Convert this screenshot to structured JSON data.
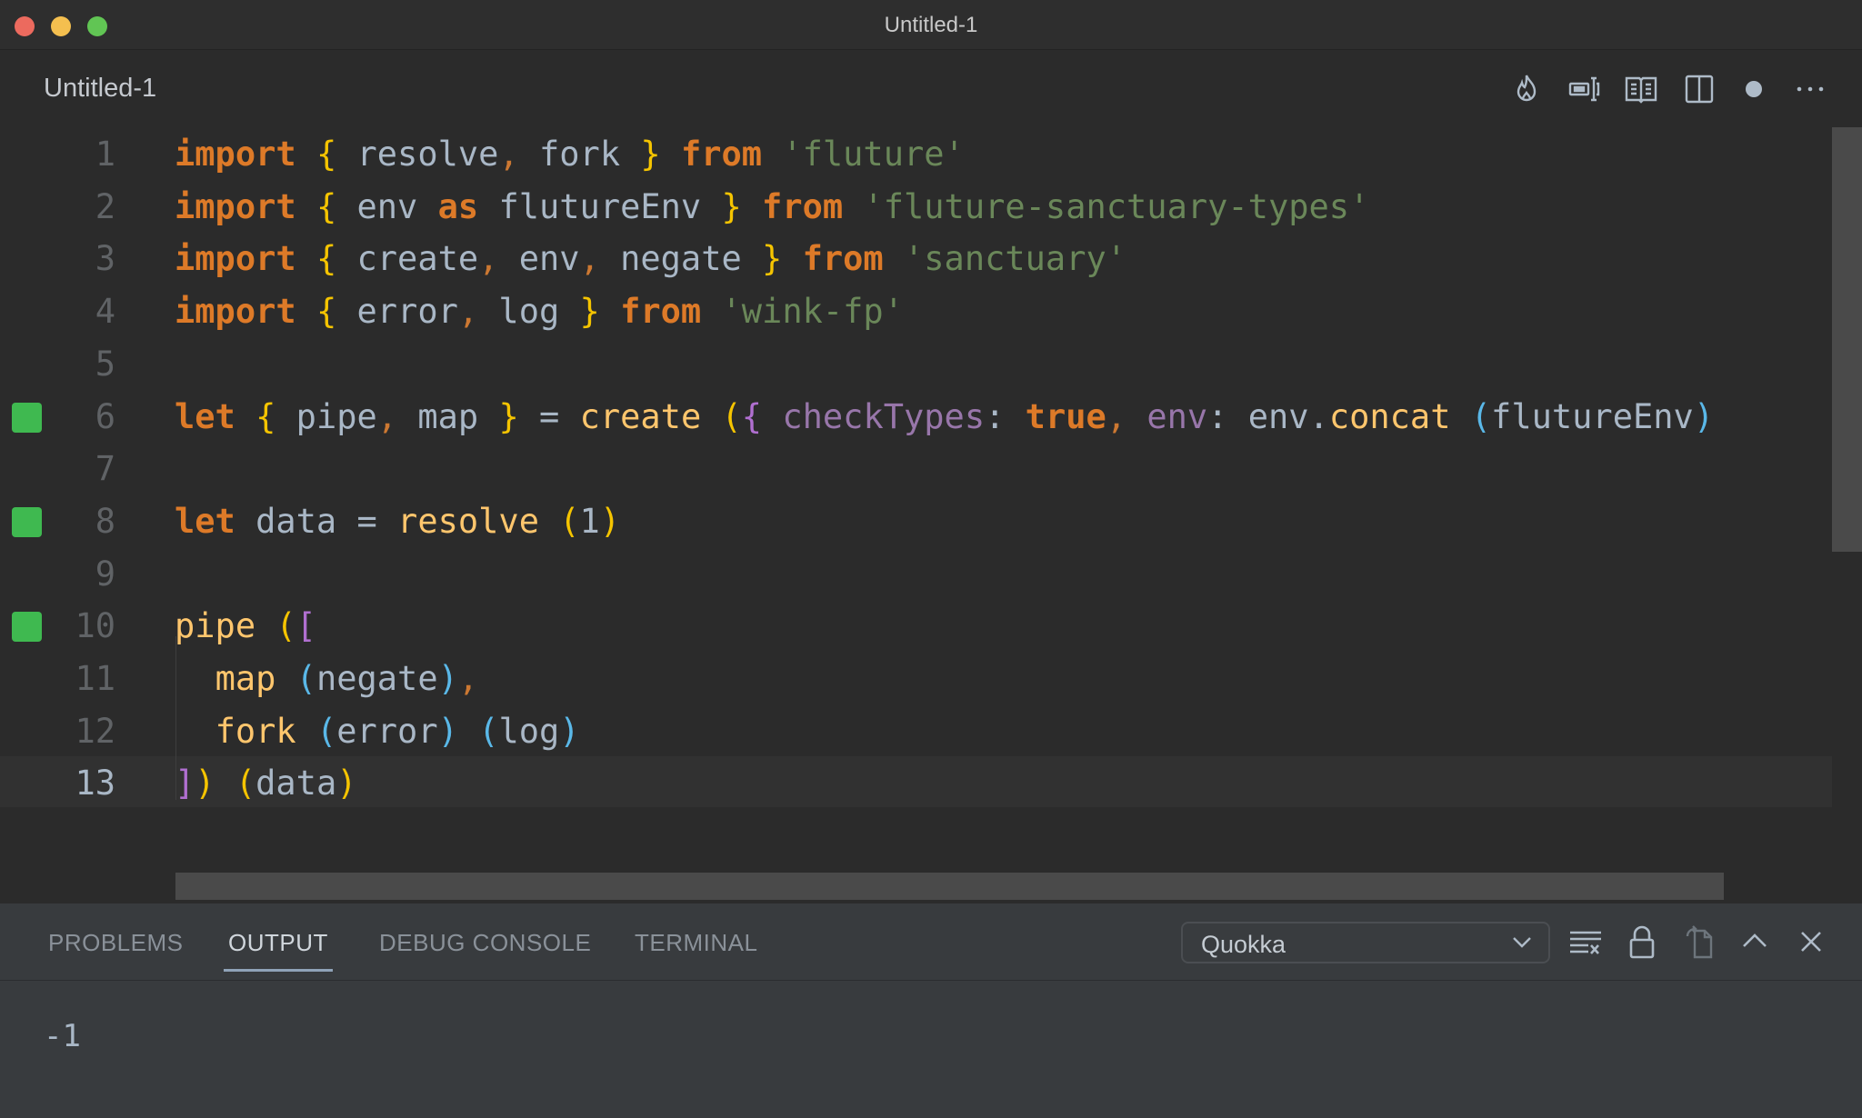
{
  "window": {
    "title": "Untitled-1"
  },
  "editor_tab": {
    "label": "Untitled-1"
  },
  "toolbar_icons": [
    "flame-icon",
    "text-cursor-icon",
    "open-preview-icon",
    "split-editor-icon",
    "unsaved-dot-icon",
    "more-actions-icon"
  ],
  "code_lines": [
    {
      "n": "1",
      "marker": false,
      "tokens": [
        [
          "import",
          "kw"
        ],
        [
          " ",
          ""
        ],
        [
          "{",
          "br"
        ],
        [
          " resolve",
          ""
        ],
        [
          ",",
          "punc"
        ],
        [
          " fork ",
          ""
        ],
        [
          "}",
          "br"
        ],
        [
          " ",
          ""
        ],
        [
          "from",
          "kw"
        ],
        [
          " ",
          ""
        ],
        [
          "'fluture'",
          "str"
        ]
      ]
    },
    {
      "n": "2",
      "marker": false,
      "tokens": [
        [
          "import",
          "kw"
        ],
        [
          " ",
          ""
        ],
        [
          "{",
          "br"
        ],
        [
          " env ",
          ""
        ],
        [
          "as",
          "kw"
        ],
        [
          " flutureEnv ",
          ""
        ],
        [
          "}",
          "br"
        ],
        [
          " ",
          ""
        ],
        [
          "from",
          "kw"
        ],
        [
          " ",
          ""
        ],
        [
          "'fluture-sanctuary-types'",
          "str"
        ]
      ]
    },
    {
      "n": "3",
      "marker": false,
      "tokens": [
        [
          "import",
          "kw"
        ],
        [
          " ",
          ""
        ],
        [
          "{",
          "br"
        ],
        [
          " create",
          ""
        ],
        [
          ",",
          "punc"
        ],
        [
          " env",
          ""
        ],
        [
          ",",
          "punc"
        ],
        [
          " negate ",
          ""
        ],
        [
          "}",
          "br"
        ],
        [
          " ",
          ""
        ],
        [
          "from",
          "kw"
        ],
        [
          " ",
          ""
        ],
        [
          "'sanctuary'",
          "str"
        ]
      ]
    },
    {
      "n": "4",
      "marker": false,
      "tokens": [
        [
          "import",
          "kw"
        ],
        [
          " ",
          ""
        ],
        [
          "{",
          "br"
        ],
        [
          " error",
          ""
        ],
        [
          ",",
          "punc"
        ],
        [
          " log ",
          ""
        ],
        [
          "}",
          "br"
        ],
        [
          " ",
          ""
        ],
        [
          "from",
          "kw"
        ],
        [
          " ",
          ""
        ],
        [
          "'wink-fp'",
          "str"
        ]
      ]
    },
    {
      "n": "5",
      "marker": false,
      "tokens": []
    },
    {
      "n": "6",
      "marker": true,
      "tokens": [
        [
          "let",
          "kw"
        ],
        [
          " ",
          ""
        ],
        [
          "{",
          "br"
        ],
        [
          " pipe",
          ""
        ],
        [
          ",",
          "punc"
        ],
        [
          " map ",
          ""
        ],
        [
          "}",
          "br"
        ],
        [
          " = ",
          ""
        ],
        [
          "create",
          "fn"
        ],
        [
          " ",
          ""
        ],
        [
          "(",
          "br"
        ],
        [
          "{",
          "pur"
        ],
        [
          " ",
          ""
        ],
        [
          "checkTypes",
          "prop"
        ],
        [
          ": ",
          ""
        ],
        [
          "true",
          "kw"
        ],
        [
          ",",
          "punc"
        ],
        [
          " ",
          ""
        ],
        [
          "env",
          "prop"
        ],
        [
          ": env.",
          ""
        ],
        [
          "concat",
          "fn"
        ],
        [
          " ",
          ""
        ],
        [
          "(",
          "blue"
        ],
        [
          "flutureEnv",
          ""
        ],
        [
          ")",
          "blue"
        ]
      ]
    },
    {
      "n": "7",
      "marker": false,
      "tokens": []
    },
    {
      "n": "8",
      "marker": true,
      "tokens": [
        [
          "let",
          "kw"
        ],
        [
          " data = ",
          ""
        ],
        [
          "resolve",
          "fn"
        ],
        [
          " ",
          ""
        ],
        [
          "(",
          "br"
        ],
        [
          "1",
          "num"
        ],
        [
          ")",
          "br"
        ]
      ]
    },
    {
      "n": "9",
      "marker": false,
      "tokens": []
    },
    {
      "n": "10",
      "marker": true,
      "tokens": [
        [
          "pipe",
          "fn"
        ],
        [
          " ",
          ""
        ],
        [
          "(",
          "br"
        ],
        [
          "[",
          "pur"
        ]
      ]
    },
    {
      "n": "11",
      "marker": false,
      "tokens": [
        [
          "  ",
          ""
        ],
        [
          "map",
          "fn"
        ],
        [
          " ",
          ""
        ],
        [
          "(",
          "blue"
        ],
        [
          "negate",
          ""
        ],
        [
          ")",
          "blue"
        ],
        [
          ",",
          "punc"
        ]
      ]
    },
    {
      "n": "12",
      "marker": false,
      "tokens": [
        [
          "  ",
          ""
        ],
        [
          "fork",
          "fn"
        ],
        [
          " ",
          ""
        ],
        [
          "(",
          "blue"
        ],
        [
          "error",
          ""
        ],
        [
          ")",
          "blue"
        ],
        [
          " ",
          ""
        ],
        [
          "(",
          "blue"
        ],
        [
          "log",
          ""
        ],
        [
          ")",
          "blue"
        ]
      ]
    },
    {
      "n": "13",
      "marker": false,
      "active": true,
      "tokens": [
        [
          "]",
          "pur"
        ],
        [
          ")",
          "br"
        ],
        [
          " ",
          ""
        ],
        [
          "(",
          "br"
        ],
        [
          "data",
          ""
        ],
        [
          ")",
          "br"
        ]
      ]
    }
  ],
  "panel": {
    "tabs": [
      {
        "label": "PROBLEMS",
        "active": false
      },
      {
        "label": "OUTPUT",
        "active": true
      },
      {
        "label": "DEBUG CONSOLE",
        "active": false
      },
      {
        "label": "TERMINAL",
        "active": false
      }
    ],
    "output_channel": "Quokka",
    "output_text": "-1"
  },
  "colors": {
    "keyword": "#dd7a28",
    "brace": "#f5c400",
    "string": "#6a8759",
    "function": "#ffc66d",
    "property": "#9876aa",
    "marker": "#3fb950"
  }
}
